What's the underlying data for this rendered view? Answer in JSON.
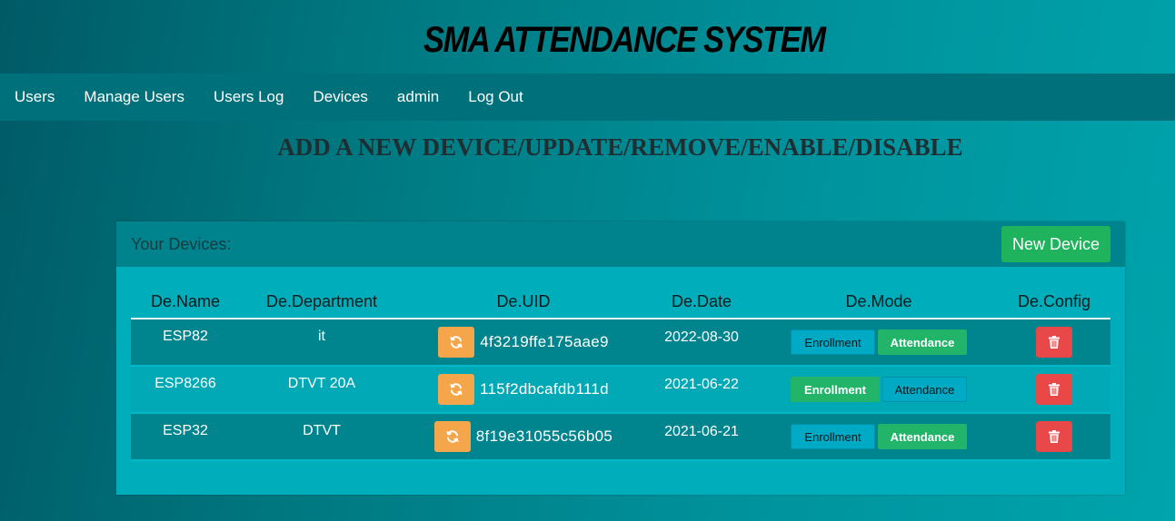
{
  "header": {
    "title": "SMA ATTENDANCE SYSTEM"
  },
  "nav": [
    {
      "label": "Users"
    },
    {
      "label": "Manage Users"
    },
    {
      "label": "Users Log"
    },
    {
      "label": "Devices"
    },
    {
      "label": "admin"
    },
    {
      "label": "Log Out"
    }
  ],
  "page": {
    "heading": "ADD A NEW DEVICE/UPDATE/REMOVE/ENABLE/DISABLE"
  },
  "panel": {
    "title": "Your Devices:",
    "new_device_label": "New Device"
  },
  "table": {
    "columns": [
      "De.Name",
      "De.Department",
      "De.UID",
      "De.Date",
      "De.Mode",
      "De.Config"
    ],
    "rows": [
      {
        "name": "ESP82",
        "department": "it",
        "uid": "4f3219ffe175aae9",
        "date": "2022-08-30",
        "enrollment": "Enrollment",
        "attendance": "Attendance",
        "active_mode": "attendance"
      },
      {
        "name": "ESP8266",
        "department": "DTVT 20A",
        "uid": "115f2dbcafdb111d",
        "date": "2021-06-22",
        "enrollment": "Enrollment",
        "attendance": "Attendance",
        "active_mode": "enrollment"
      },
      {
        "name": "ESP32",
        "department": "DTVT",
        "uid": "8f19e31055c56b05",
        "date": "2021-06-21",
        "enrollment": "Enrollment",
        "attendance": "Attendance",
        "active_mode": "attendance"
      }
    ]
  },
  "icons": {
    "refresh": "refresh-icon",
    "delete": "trash-icon"
  },
  "colors": {
    "nav_bg": "#00707a",
    "panel_bg": "#00adba",
    "new_device": "#1eb35c",
    "refresh_button": "#f5a64a",
    "delete_button": "#e84848",
    "mode_active": "#22b56a"
  }
}
